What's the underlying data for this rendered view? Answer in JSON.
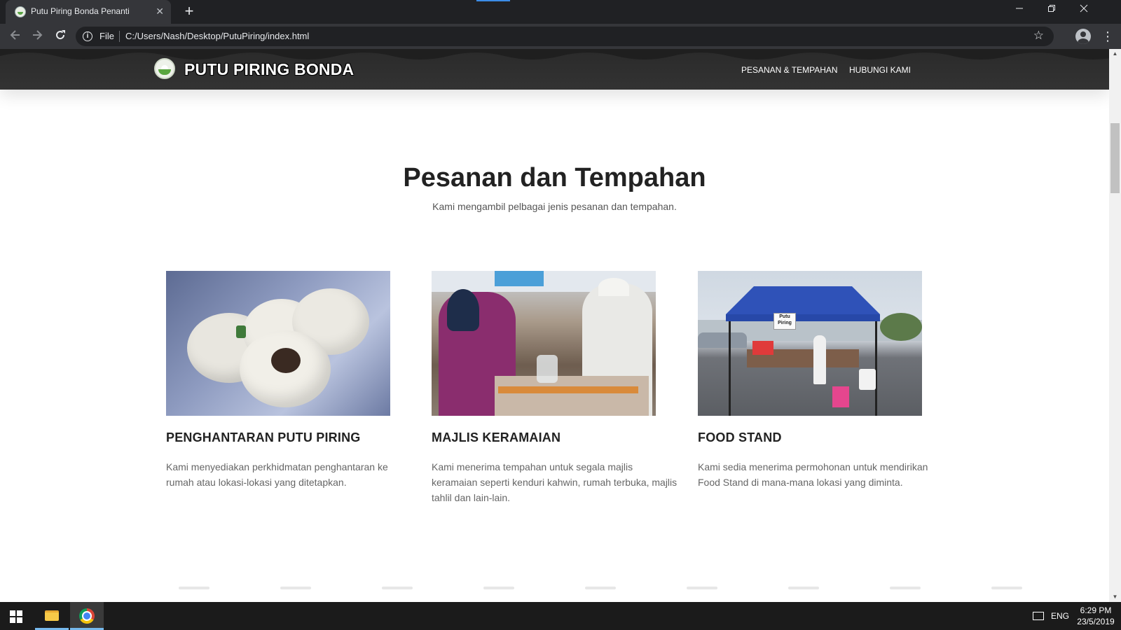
{
  "browser": {
    "tab_title": "Putu Piring Bonda Penanti",
    "tab_close": "✕",
    "new_tab": "+",
    "scheme_label": "File",
    "url": "C:/Users/Nash/Desktop/PutuPiring/index.html",
    "icons": [
      "back-icon",
      "forward-icon",
      "reload-icon",
      "info-icon",
      "star-icon",
      "avatar-icon",
      "menu-icon"
    ]
  },
  "site": {
    "brand": "PUTU PIRING BONDA",
    "nav": [
      "PESANAN & TEMPAHAN",
      "HUBUNGI KAMI"
    ]
  },
  "section": {
    "title": "Pesanan dan Tempahan",
    "subtitle": "Kami mengambil pelbagai jenis pesanan dan tempahan."
  },
  "cards": [
    {
      "title": "PENGHANTARAN PUTU PIRING",
      "text": "Kami menyediakan perkhidmatan penghantaran ke rumah atau lokasi-lokasi yang ditetapkan."
    },
    {
      "title": "MAJLIS KERAMAIAN",
      "text": "Kami menerima tempahan untuk segala majlis keramaian seperti kenduri kahwin, rumah terbuka, majlis tahlil dan lain-lain."
    },
    {
      "title": "FOOD STAND",
      "text": "Kami sedia menerima permohonan untuk mendirikan Food Stand di mana-mana lokasi yang diminta.",
      "sign_text": "Putu Piring"
    }
  ],
  "taskbar": {
    "language": "ENG",
    "time": "6:29 PM",
    "date": "23/5/2019"
  },
  "colors": {
    "header_bg": "#2f2f2f",
    "chrome_dark": "#202124",
    "accent_blue": "#3c8ce7"
  }
}
